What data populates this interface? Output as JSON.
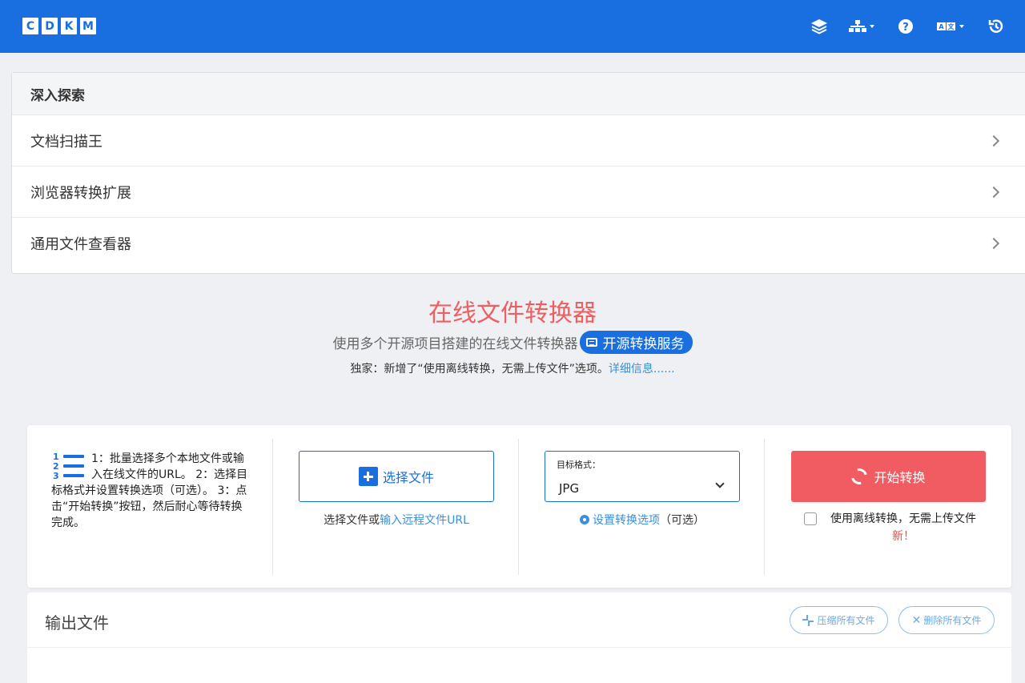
{
  "header": {
    "logo_letters": [
      "C",
      "D",
      "K",
      "M"
    ],
    "icons": [
      "layers-icon",
      "sitemap-icon",
      "help-icon",
      "language-icon",
      "history-icon"
    ]
  },
  "explore": {
    "title": "深入探索",
    "items": [
      {
        "label": "文档扫描王"
      },
      {
        "label": "浏览器转换扩展"
      },
      {
        "label": "通用文件查看器"
      }
    ]
  },
  "hero": {
    "title": "在线文件转换器",
    "subtitle": "使用多个开源项目搭建的在线文件转换器",
    "pill_label": "开源转换服务",
    "note_prefix": "独家：新增了“使用离线转换，无需上传文件”选项。",
    "note_link": "详细信息......"
  },
  "converter": {
    "steps_text": "1：批量选择多个本地文件或输入在线文件的URL。 2：选择目标格式并设置转换选项（可选）。 3：点击“开始转换”按钮，然后耐心等待转换完成。",
    "select_button": "选择文件",
    "select_hint_prefix": "选择文件或",
    "select_hint_link": "输入远程文件URL",
    "format_label": "目标格式：",
    "format_value": "JPG",
    "options_link": "设置转换选项",
    "options_suffix": "（可选）",
    "start_button": "开始转换",
    "offline_text": "使用离线转换，无需上传文件",
    "offline_new": "新！"
  },
  "output": {
    "title": "输出文件",
    "compress_button": "压缩所有文件",
    "delete_button": "删除所有文件"
  },
  "colors": {
    "brand_blue": "#1a6fe0",
    "accent_red": "#f15c63",
    "link_blue": "#3a8fde"
  }
}
